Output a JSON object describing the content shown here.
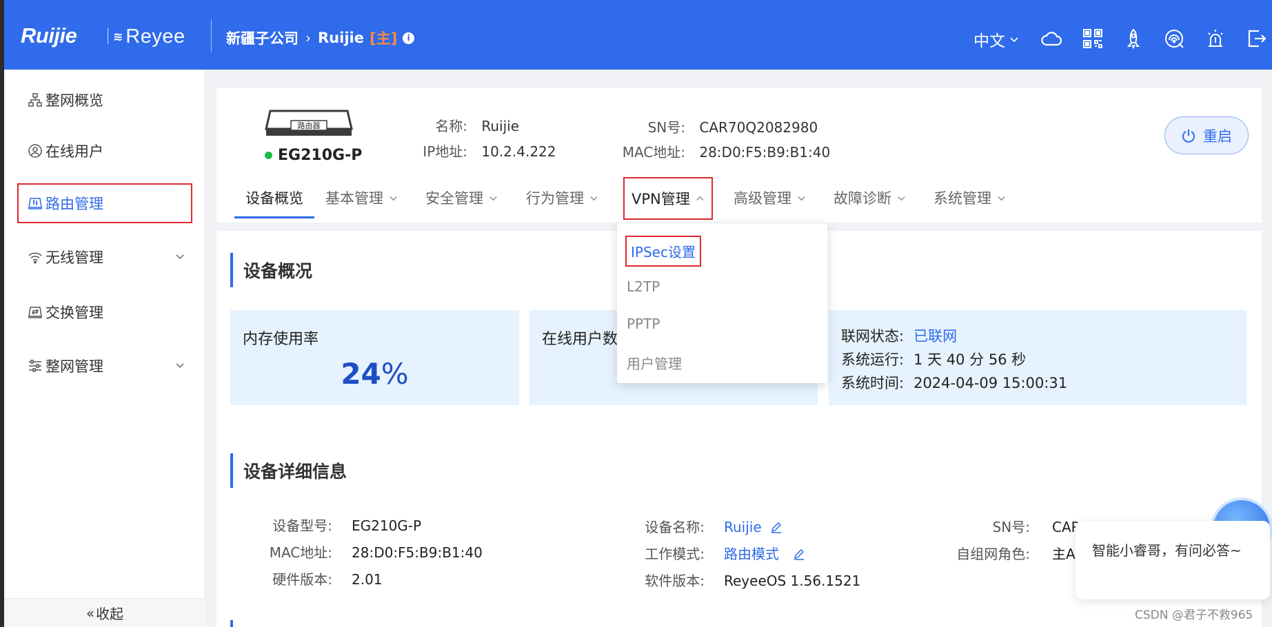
{
  "header": {
    "logo_ruijie": "Ruijie",
    "logo_reyee": "Reyee",
    "breadcrumb": {
      "company": "新疆子公司",
      "device": "Ruijie",
      "role": "[主]"
    },
    "language": "中文"
  },
  "sidebar": {
    "items": [
      {
        "label": "整网概览"
      },
      {
        "label": "在线用户"
      },
      {
        "label": "路由管理"
      },
      {
        "label": "无线管理"
      },
      {
        "label": "交换管理"
      },
      {
        "label": "整网管理"
      }
    ],
    "collapse_label": "收起"
  },
  "device": {
    "router_badge": "路由器",
    "model": "EG210G-P",
    "name_label": "名称:",
    "name_value": "Ruijie",
    "ip_label": "IP地址:",
    "ip_value": "10.2.4.222",
    "sn_label": "SN号:",
    "sn_value": "CAR70Q2082980",
    "mac_label": "MAC地址:",
    "mac_value": "28:D0:F5:B9:B1:40",
    "reboot_label": "重启"
  },
  "tabs": [
    {
      "label": "设备概览"
    },
    {
      "label": "基本管理"
    },
    {
      "label": "安全管理"
    },
    {
      "label": "行为管理"
    },
    {
      "label": "VPN管理"
    },
    {
      "label": "高级管理"
    },
    {
      "label": "故障诊断"
    },
    {
      "label": "系统管理"
    }
  ],
  "vpn_menu": {
    "items": [
      {
        "label": "IPSec设置"
      },
      {
        "label": "L2TP"
      },
      {
        "label": "PPTP"
      },
      {
        "label": "用户管理"
      }
    ]
  },
  "overview": {
    "title": "设备概况",
    "memory_label": "内存使用率",
    "memory_value": "24",
    "memory_unit": "%",
    "memory_percent": 24,
    "online_users_label": "在线用户数",
    "net_status_label": "联网状态:",
    "net_status_value": "已联网",
    "uptime_label": "系统运行:",
    "uptime_value": "1 天 40 分 56 秒",
    "systime_label": "系统时间:",
    "systime_value": "2024-04-09 15:00:31"
  },
  "details": {
    "title": "设备详细信息",
    "model_label": "设备型号:",
    "model_value": "EG210G-P",
    "mac_label": "MAC地址:",
    "mac_value": "28:D0:F5:B9:B1:40",
    "hw_label": "硬件版本:",
    "hw_value": "2.01",
    "devname_label": "设备名称:",
    "devname_value": "Ruijie",
    "workmode_label": "工作模式:",
    "workmode_value": "路由模式",
    "sw_label": "软件版本:",
    "sw_value": "ReyeeOS 1.56.1521",
    "sn_label": "SN号:",
    "sn_value": "CAR",
    "role_label": "自组网角色:",
    "role_value": "主AC"
  },
  "assistant": {
    "message": "智能小睿哥，有问必答~"
  },
  "watermark": "CSDN @君子不救965",
  "colors": {
    "header": "#2f6bea",
    "accent": "#2f6bea",
    "highlight_box": "#e0282e",
    "online": "#1dbb4a",
    "stat_bg": "#e6f2fd"
  }
}
